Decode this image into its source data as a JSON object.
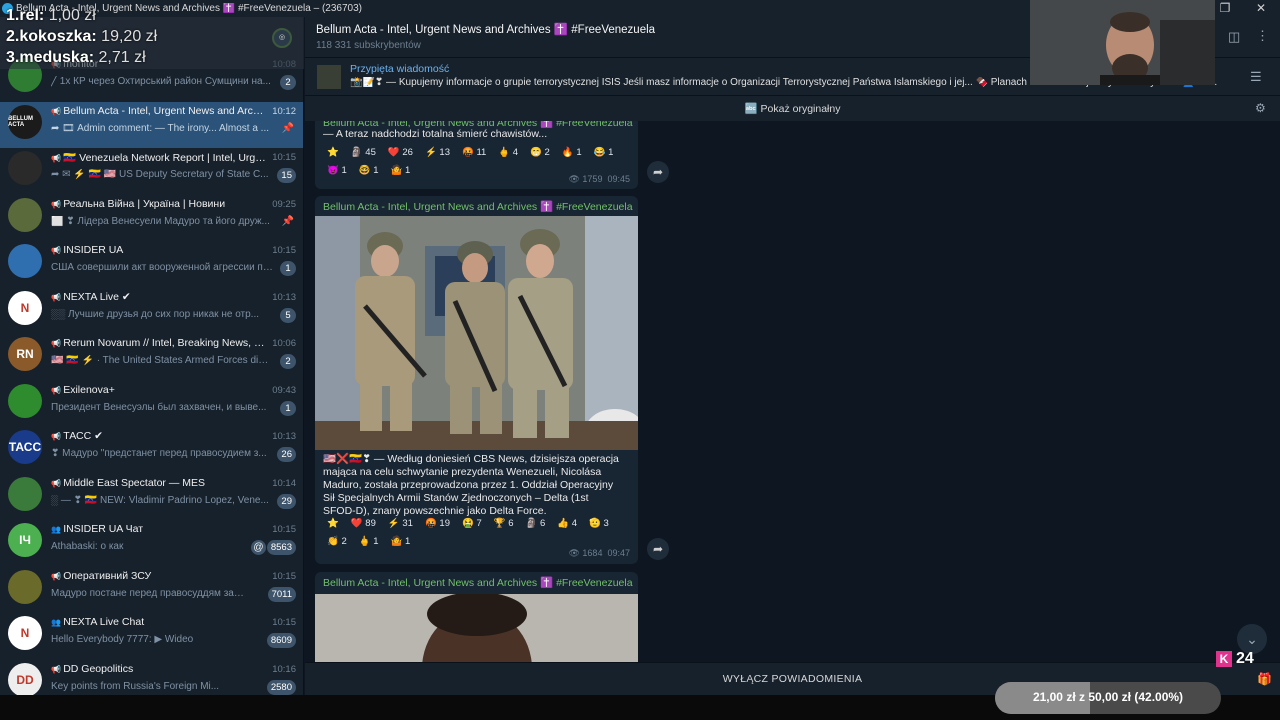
{
  "window": {
    "title": "Bellum Acta - Intel, Urgent News and Archives ✝️ #FreeVenezuela – (236703)"
  },
  "overlay": {
    "rank1_label": "1.rel:",
    "rank1_value": "1,00 zł",
    "rank2_label": "2.kokoszka:",
    "rank2_value": "19,20 zł",
    "rank3_label": "3.meduska:",
    "rank3_value": "2,71 zł"
  },
  "chats": [
    {
      "name": "monitor",
      "time": "10:08",
      "preview": "╱ 1х КР через Охтирський район Сумщини на...",
      "badge": "2",
      "avatar": "",
      "avatar_color": "#2e7d32"
    },
    {
      "name": "Bellum Acta - Intel, Urgent News and Archi...",
      "time": "10:12",
      "preview": "➦ 🎞 Admin comment: — The irony... Almost a ...",
      "badge": "",
      "avatar": "BELLUM ACTA",
      "avatar_color": "#1b1b1b",
      "active": true
    },
    {
      "name": "🇻🇪 Venezuela Network Report | Intel, Urge...",
      "time": "10:15",
      "preview": "➦ ✉ ⚡ 🇻🇪 🇺🇸 US Deputy Secretary of State C...",
      "badge": "15",
      "avatar": "",
      "avatar_color": "#2a2a2a"
    },
    {
      "name": "Реальна Війна | Україна | Новини",
      "time": "09:25",
      "preview": "⬜ ❣ Лідера Венесуели Мадуро та його друж...",
      "badge": "",
      "avatar": "",
      "avatar_color": "#5a6a3a",
      "muted_pin": true
    },
    {
      "name": "INSIDER UA",
      "time": "10:15",
      "preview": "США совершили акт вооруженной агрессии пр...",
      "badge": "1",
      "avatar": "",
      "avatar_color": "#2f6fb0"
    },
    {
      "name": "NEXTA Live ✔",
      "time": "10:13",
      "preview": "░░ Лучшие друзья до сих пор никак не отр...",
      "badge": "5",
      "avatar": "N",
      "avatar_color": "#ffffff"
    },
    {
      "name": "Rerum Novarum // Intel, Breaking News, a...",
      "time": "10:06",
      "preview": "🇺🇸 🇻🇪 ⚡ · The United States Armed Forces did n...",
      "badge": "2",
      "avatar": "RN",
      "avatar_color": "#8a5a2a"
    },
    {
      "name": "Exilenova+",
      "time": "09:43",
      "preview": "Президент Венесуэлы был захвачен, и выве...",
      "badge": "1",
      "avatar": "",
      "avatar_color": "#2e8b2e"
    },
    {
      "name": "ТАСС ✔",
      "time": "10:13",
      "preview": "❣ Мадуро \"предстанет перед правосудием з...",
      "badge": "26",
      "avatar": "ТАСС",
      "avatar_color": "#1a3a8a"
    },
    {
      "name": "Middle East Spectator — MES",
      "time": "10:14",
      "preview": "░ — ❣ 🇻🇪 NEW: Vladimir Padrino Lopez, Vene...",
      "badge": "29",
      "avatar": "",
      "avatar_color": "#3a7a3a"
    },
    {
      "name": "INSIDER UA Чат",
      "time": "10:15",
      "preview": "Athabaski: о как",
      "badge": "8563",
      "avatar": "ІЧ",
      "avatar_color": "#4caf50",
      "mention": true,
      "group": true
    },
    {
      "name": "Оперативний ЗСУ",
      "time": "10:15",
      "preview": "Мадуро постане перед правосуддям за свої ...",
      "badge": "7011",
      "avatar": "",
      "avatar_color": "#6a6a2a"
    },
    {
      "name": "NEXTA Live Chat",
      "time": "10:15",
      "preview": "Hello Everybody 7777: ▶ Wideo",
      "badge": "8609",
      "avatar": "N",
      "avatar_color": "#ffffff",
      "group": true
    },
    {
      "name": "DD Geopolitics",
      "time": "10:16",
      "preview": "Key points from Russia's Foreign Mi...",
      "badge": "2580",
      "avatar": "DD",
      "avatar_color": "#eeeeee"
    }
  ],
  "header": {
    "channel_title": "Bellum Acta - Intel, Urgent News and Archives ✝️ #FreeVenezuela",
    "subscribers": "118 331 subskrybentów"
  },
  "pinned": {
    "label": "Przypięta wiadomość",
    "text": "📸📝❣ — Kupujemy informacje o grupie terrorystycznej ISIS  Jeśli masz informacje o Organizacji Terrorystycznej Państwa Islamskiego i jej... 🍫 Planach ataku · Podejrzanych terrorystach 👤 Ad..."
  },
  "translate": {
    "label": "Pokaż oryginałny"
  },
  "messages": [
    {
      "sender": "Bellum Acta - Intel, Urgent News and Archives ✝️ #FreeVenezuela",
      "text": "— A teraz nadchodzi totalna śmierć chawistów...",
      "reactions": [
        "⭐",
        "🗿 45",
        "❤️ 26",
        "⚡ 13",
        "🤬 11",
        "🖕 4",
        "😁 2",
        "🔥 1",
        "😂 1",
        "😈 1",
        "🤓 1",
        "🤷 1"
      ],
      "views": "👁 1759",
      "time": "09:45"
    },
    {
      "sender": "Bellum Acta - Intel, Urgent News and Archives ✝️ #FreeVenezuela",
      "text": "🇺🇸❌🇻🇪❣ — Według doniesień CBS News, dzisiejsza operacja mająca na celu schwytanie prezydenta Wenezueli, Nicolása Maduro, została przeprowadzona przez 1. Oddział Operacyjny Sił Specjalnych Armii Stanów Zjednoczonych – Delta (1st SFOD-D), znany powszechnie jako Delta Force.",
      "reactions": [
        "⭐",
        "❤️ 89",
        "⚡ 31",
        "🤬 19",
        "🤮 7",
        "🏆 6",
        "🗿 6",
        "👍 4",
        "🫡 3",
        "👏 2",
        "🖕 1",
        "🤷 1"
      ],
      "views": "👁 1684",
      "time": "09:47"
    },
    {
      "sender": "Bellum Acta - Intel, Urgent News and Archives ✝️ #FreeVenezuela"
    }
  ],
  "bottom": {
    "mute_label": "WYŁĄCZ POWIADOMIENIA"
  },
  "donation": {
    "text": "21,00 zł z 50,00 zł (42.00%)",
    "progress_percent": 42
  },
  "viewer_badge": {
    "count": "24"
  }
}
